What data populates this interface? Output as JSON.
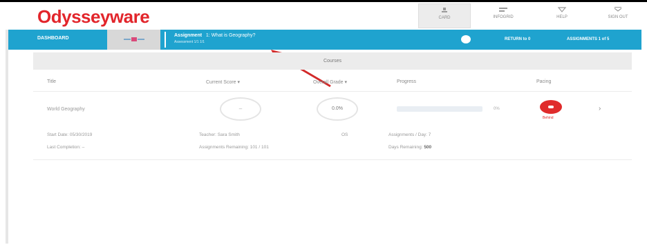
{
  "header": {
    "logo": "Odysseyware",
    "top_buttons": [
      {
        "label": "CARD",
        "icon": "card-icon"
      },
      {
        "label": "INFOGRID",
        "icon": "infogrid-icon"
      },
      {
        "label": "HELP",
        "icon": "help-icon"
      },
      {
        "label": "SIGN OUT",
        "icon": "sign-out-icon"
      }
    ]
  },
  "navbar": {
    "home": "DASHBOARD",
    "tab_icon": "calendar-icon",
    "assignment_label": "Assignment",
    "assignment_title": "1: What is Geography?",
    "assignment_sub": "Assessment 1/1 1/1",
    "chat_icon": "chat-icon",
    "right_1": "RETURN to 0",
    "right_2": "ASSIGNMENTS 1 of 5"
  },
  "courses": {
    "header": "Courses",
    "columns": [
      "Title",
      "Current Score",
      "Overall Grade",
      "Progress",
      "Pacing"
    ],
    "row": {
      "title": "World Geography",
      "current_score": "–",
      "overall_grade": "0.0%",
      "progress_pct": "0%",
      "progress": 0,
      "pacing": "Behind",
      "pacing_color": "#e02b2b",
      "chevron": "›"
    },
    "details": {
      "start_date": "Start Date: 05/30/2019",
      "teacher": "Teacher: Sara Smith",
      "extra": "OS",
      "assignments_day": "Assignments / Day: 7",
      "last_completion": "Last Completion: –",
      "assignments_remaining": "Assignments Remaining: 101 / 101",
      "days_remaining_label": "Days Remaining:",
      "days_remaining_value": "500"
    }
  },
  "colors": {
    "brand": "#e2252b",
    "nav": "#1fa3cf",
    "arrow": "#d22a2a"
  }
}
